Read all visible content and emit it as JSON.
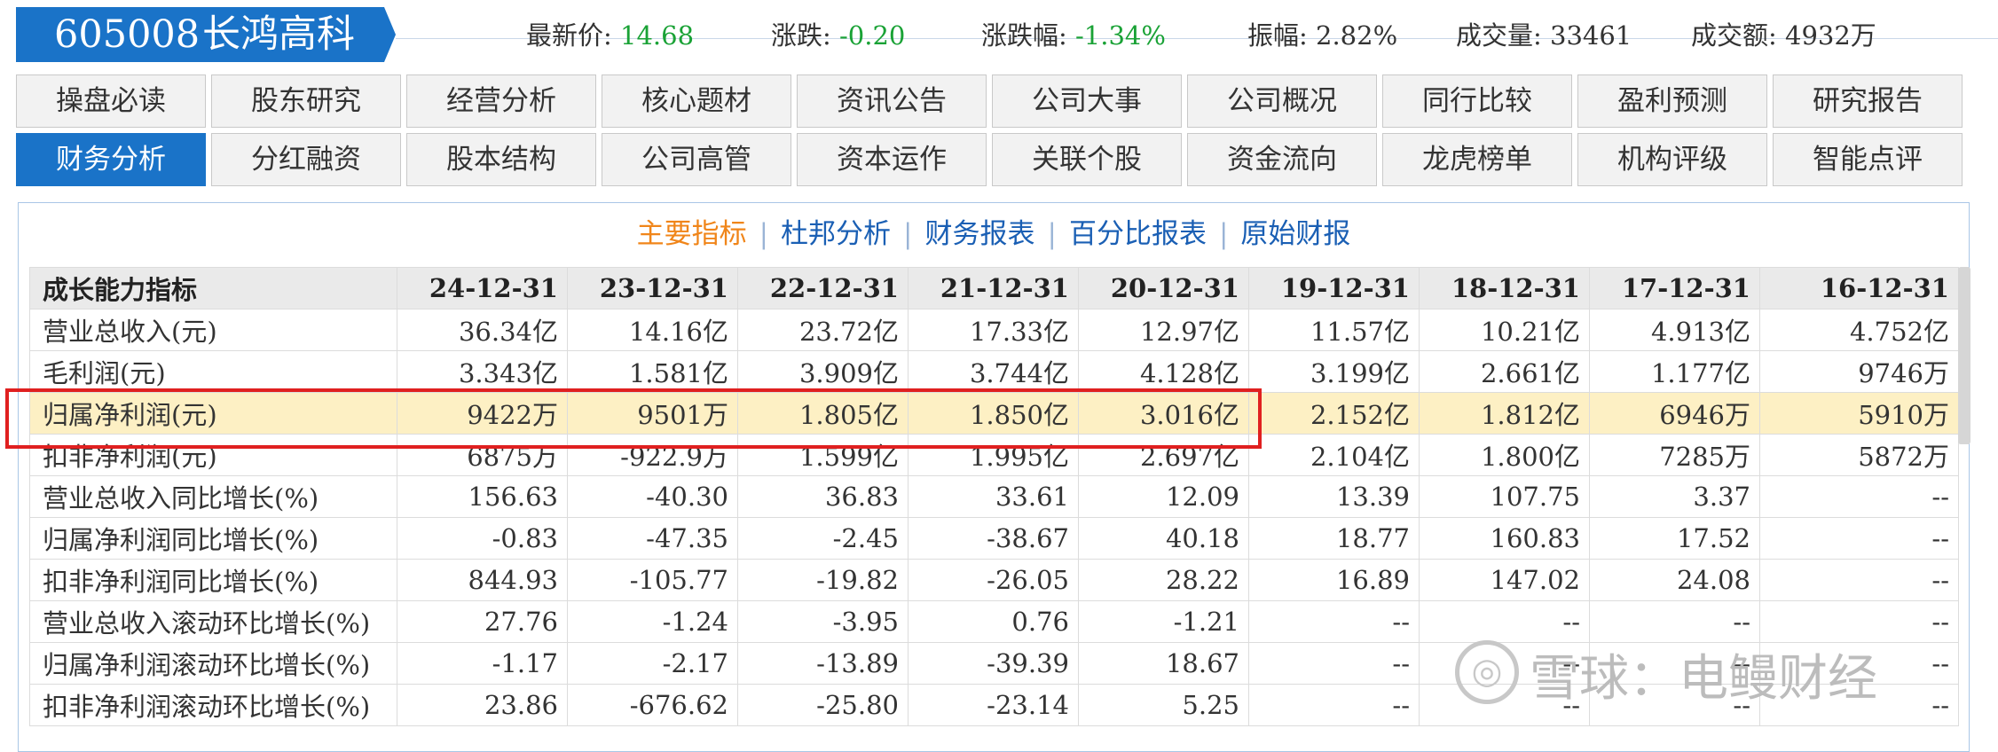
{
  "header": {
    "stock_code": "605008",
    "stock_name": "长鸿高科",
    "quotes": [
      {
        "label": "最新价:",
        "value": "14.68"
      },
      {
        "label": "涨跌:",
        "value": "-0.20"
      },
      {
        "label": "涨跌幅:",
        "value": "-1.34%"
      },
      {
        "label": "振幅:",
        "value": "2.82%"
      },
      {
        "label": "成交量:",
        "value": "33461"
      },
      {
        "label": "成交额:",
        "value": "4932万"
      }
    ]
  },
  "tabs_row1": [
    "操盘必读",
    "股东研究",
    "经营分析",
    "核心题材",
    "资讯公告",
    "公司大事",
    "公司概况",
    "同行比较",
    "盈利预测",
    "研究报告"
  ],
  "tabs_row2": [
    "财务分析",
    "分红融资",
    "股本结构",
    "公司高管",
    "资本运作",
    "关联个股",
    "资金流向",
    "龙虎榜单",
    "机构评级",
    "智能点评"
  ],
  "subnav": [
    "主要指标",
    "杜邦分析",
    "财务报表",
    "百分比报表",
    "原始财报"
  ],
  "table": {
    "header": [
      "成长能力指标",
      "24-12-31",
      "23-12-31",
      "22-12-31",
      "21-12-31",
      "20-12-31",
      "19-12-31",
      "18-12-31",
      "17-12-31",
      "16-12-31"
    ],
    "rows": [
      [
        "营业总收入(元)",
        "36.34亿",
        "14.16亿",
        "23.72亿",
        "17.33亿",
        "12.97亿",
        "11.57亿",
        "10.21亿",
        "4.913亿",
        "4.752亿"
      ],
      [
        "毛利润(元)",
        "3.343亿",
        "1.581亿",
        "3.909亿",
        "3.744亿",
        "4.128亿",
        "3.199亿",
        "2.661亿",
        "1.177亿",
        "9746万"
      ],
      [
        "归属净利润(元)",
        "9422万",
        "9501万",
        "1.805亿",
        "1.850亿",
        "3.016亿",
        "2.152亿",
        "1.812亿",
        "6946万",
        "5910万"
      ],
      [
        "扣非净利润(元)",
        "6875万",
        "-922.9万",
        "1.599亿",
        "1.995亿",
        "2.697亿",
        "2.104亿",
        "1.800亿",
        "7285万",
        "5872万"
      ],
      [
        "营业总收入同比增长(%)",
        "156.63",
        "-40.30",
        "36.83",
        "33.61",
        "12.09",
        "13.39",
        "107.75",
        "3.37",
        "--"
      ],
      [
        "归属净利润同比增长(%)",
        "-0.83",
        "-47.35",
        "-2.45",
        "-38.67",
        "40.18",
        "18.77",
        "160.83",
        "17.52",
        "--"
      ],
      [
        "扣非净利润同比增长(%)",
        "844.93",
        "-105.77",
        "-19.82",
        "-26.05",
        "28.22",
        "16.89",
        "147.02",
        "24.08",
        "--"
      ],
      [
        "营业总收入滚动环比增长(%)",
        "27.76",
        "-1.24",
        "-3.95",
        "0.76",
        "-1.21",
        "--",
        "--",
        "--",
        "--"
      ],
      [
        "归属净利润滚动环比增长(%)",
        "-1.17",
        "-2.17",
        "-13.89",
        "-39.39",
        "18.67",
        "--",
        "--",
        "--",
        "--"
      ],
      [
        "扣非净利润滚动环比增长(%)",
        "23.86",
        "-676.62",
        "-25.80",
        "-23.14",
        "5.25",
        "--",
        "--",
        "--",
        "--"
      ]
    ],
    "highlight_row": 2
  },
  "watermark": "雪球：电鳗财经"
}
